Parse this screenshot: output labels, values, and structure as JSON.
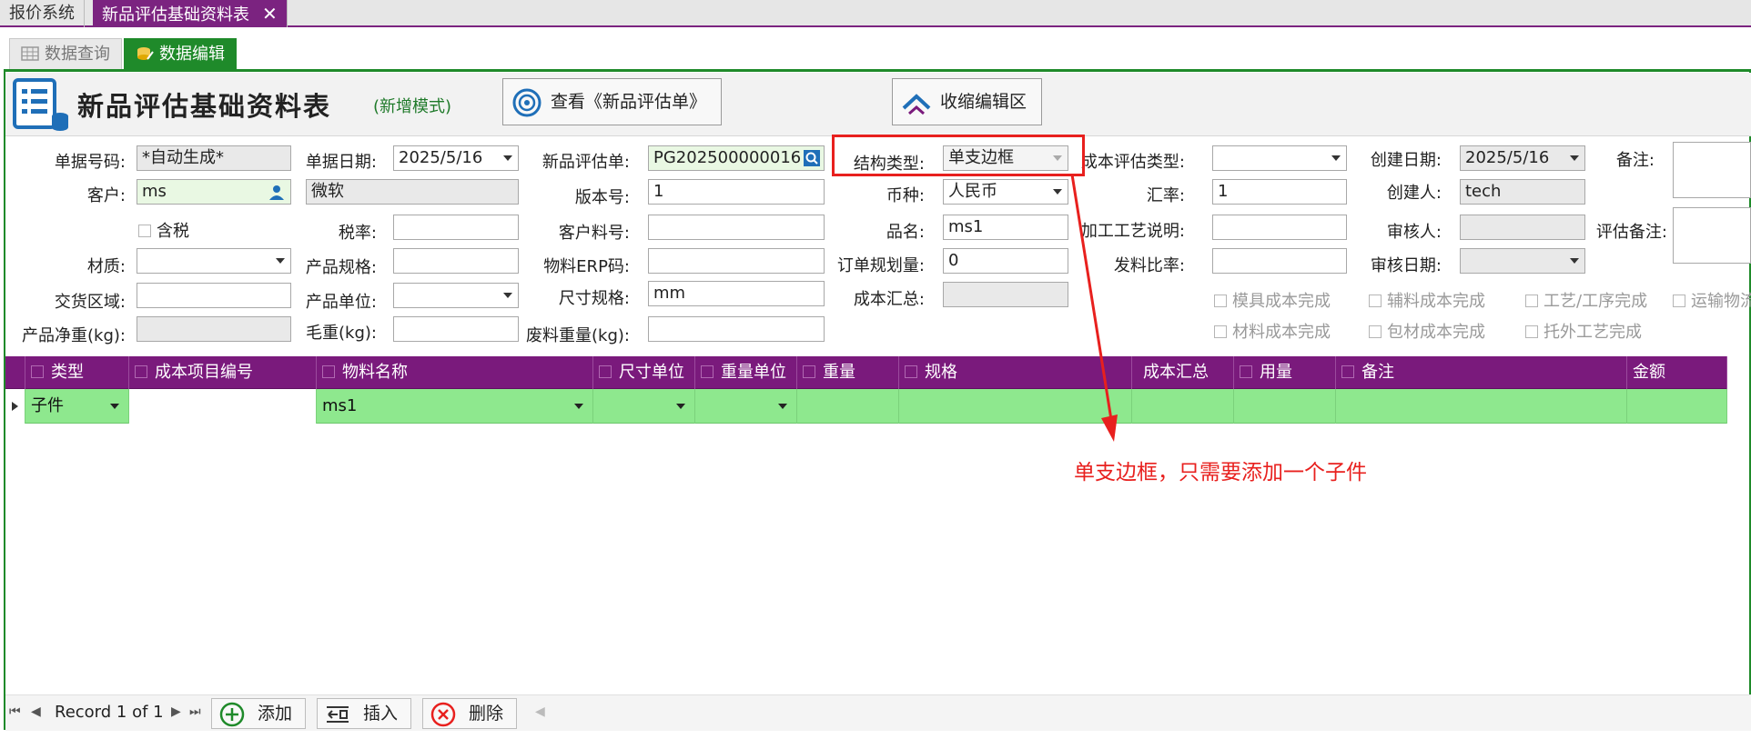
{
  "doc_tabs": [
    {
      "label": "报价系统"
    },
    {
      "label": "新品评估基础资料表",
      "close": "✕"
    }
  ],
  "view_tabs": [
    {
      "label": "数据查询"
    },
    {
      "label": "数据编辑"
    }
  ],
  "header": {
    "title": "新品评估基础资料表",
    "mode": "(新增模式)",
    "view_button": "查看《新品评估单》",
    "collapse_button": "收缩编辑区"
  },
  "form": {
    "bill_no": {
      "label": "单据号码:",
      "value": "*自动生成*"
    },
    "bill_date": {
      "label": "单据日期:",
      "value": "2025/5/16"
    },
    "eval_no": {
      "label": "新品评估单:",
      "value": "PG202500000016"
    },
    "struct_type": {
      "label": "结构类型:",
      "value": "单支边框"
    },
    "cost_eval_type": {
      "label": "成本评估类型:",
      "value": ""
    },
    "create_date": {
      "label": "创建日期:",
      "value": "2025/5/16"
    },
    "remark": {
      "label": "备注:",
      "value": ""
    },
    "customer": {
      "label": "客户:",
      "value": "ms",
      "name": "微软"
    },
    "version": {
      "label": "版本号:",
      "value": "1"
    },
    "currency": {
      "label": "币种:",
      "value": "人民币"
    },
    "rate": {
      "label": "汇率:",
      "value": "1"
    },
    "creator": {
      "label": "创建人:",
      "value": "tech"
    },
    "tax_included": {
      "label": "含税"
    },
    "tax_rate": {
      "label": "税率:",
      "value": ""
    },
    "cust_part_no": {
      "label": "客户料号:",
      "value": ""
    },
    "product_name": {
      "label": "品名:",
      "value": "ms1"
    },
    "process_desc": {
      "label": "加工工艺说明:",
      "value": ""
    },
    "auditor": {
      "label": "审核人:",
      "value": ""
    },
    "eval_remark": {
      "label": "评估备注:",
      "value": ""
    },
    "material": {
      "label": "材质:",
      "value": ""
    },
    "spec": {
      "label": "产品规格:",
      "value": ""
    },
    "erp_code": {
      "label": "物料ERP码:",
      "value": ""
    },
    "order_qty": {
      "label": "订单规划量:",
      "value": "0"
    },
    "issue_ratio": {
      "label": "发料比率:",
      "value": ""
    },
    "audit_date": {
      "label": "审核日期:",
      "value": ""
    },
    "delivery_area": {
      "label": "交货区域:",
      "value": ""
    },
    "unit": {
      "label": "产品单位:",
      "value": ""
    },
    "size_spec": {
      "label": "尺寸规格:",
      "value": "mm"
    },
    "cost_total": {
      "label": "成本汇总:",
      "value": ""
    },
    "net_weight": {
      "label": "产品净重(kg):",
      "value": ""
    },
    "gross_weight": {
      "label": "毛重(kg):",
      "value": ""
    },
    "scrap_weight": {
      "label": "废料重量(kg):",
      "value": ""
    }
  },
  "checks": [
    "模具成本完成",
    "辅料成本完成",
    "工艺/工序完成",
    "运输物流",
    "材料成本完成",
    "包材成本完成",
    "托外工艺完成"
  ],
  "grid": {
    "columns": [
      "类型",
      "成本项目编号",
      "物料名称",
      "尺寸单位",
      "重量单位",
      "重量",
      "规格",
      "成本汇总",
      "用量",
      "备注",
      "金额"
    ],
    "rows": [
      {
        "type": "子件",
        "cost_item_no": "",
        "material_name": "ms1",
        "size_unit": "",
        "weight_unit": "",
        "weight": "",
        "spec": "",
        "cost_total": "",
        "qty": "",
        "remark": "",
        "amount": ""
      }
    ]
  },
  "annotation": "单支边框，只需要添加一个子件",
  "footer": {
    "record": "Record 1 of 1",
    "add": "添加",
    "insert": "插入",
    "delete": "删除"
  },
  "colors": {
    "accent_purple": "#7a1a7c",
    "accent_green": "#1f8a2a",
    "row_green": "#8ee88e",
    "annotation_red": "#e8201e"
  }
}
